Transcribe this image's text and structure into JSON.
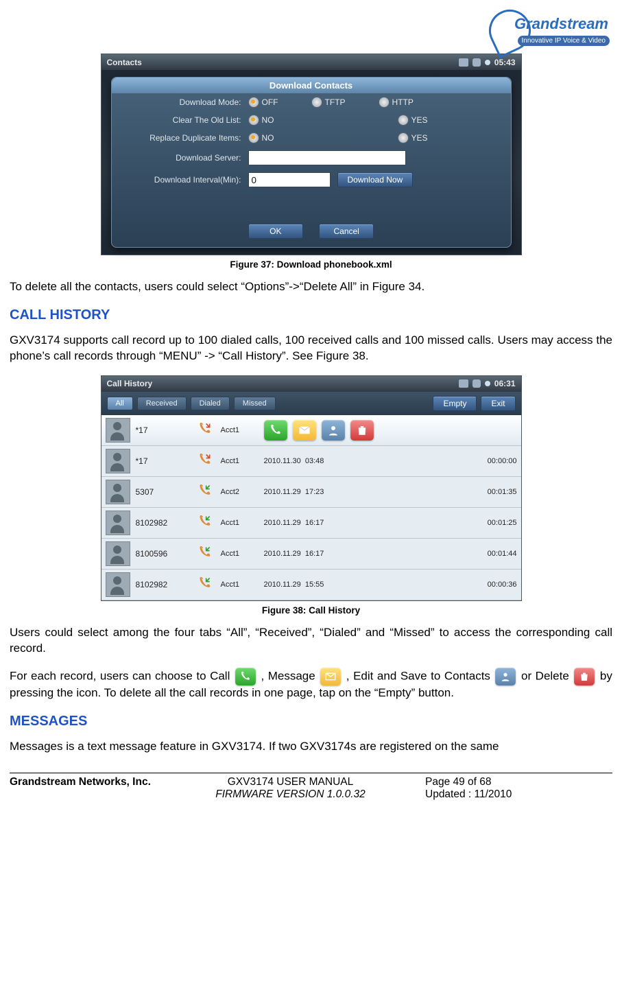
{
  "logo": {
    "brand": "Grandstream",
    "tagline": "Innovative IP Voice & Video"
  },
  "figure37": {
    "title": "Contacts",
    "clock": "05:43",
    "modal_title": "Download Contacts",
    "labels": {
      "mode": "Download Mode:",
      "clear": "Clear The Old List:",
      "replace": "Replace Duplicate Items:",
      "server": "Download Server:",
      "interval": "Download Interval(Min):"
    },
    "opts": {
      "off": "OFF",
      "tftp": "TFTP",
      "http": "HTTP",
      "no": "NO",
      "yes": "YES"
    },
    "interval_value": "0",
    "btn_download": "Download Now",
    "btn_ok": "OK",
    "btn_cancel": "Cancel",
    "caption": "Figure 37: Download phonebook.xml"
  },
  "para_delete": "To delete all the contacts, users could select “Options”->“Delete All” in Figure 34.",
  "heading_callhistory": "CALL HISTORY",
  "para_callhistory": "GXV3174 supports call record up to 100 dialed calls, 100 received calls and 100 missed calls. Users may access the phone’s call records through “MENU” -> “Call History”. See Figure 38.",
  "figure38": {
    "title": "Call History",
    "clock": "06:31",
    "tabs": {
      "all": "All",
      "received": "Received",
      "dialed": "Dialed",
      "missed": "Missed"
    },
    "btn_empty": "Empty",
    "btn_exit": "Exit",
    "rows": [
      {
        "num": "*17",
        "acct": "Acct1",
        "date": "",
        "time": "",
        "dur": "",
        "type": "missed",
        "hl": true
      },
      {
        "num": "*17",
        "acct": "Acct1",
        "date": "2010.11.30",
        "time": "03:48",
        "dur": "00:00:00",
        "type": "missed"
      },
      {
        "num": "5307",
        "acct": "Acct2",
        "date": "2010.11.29",
        "time": "17:23",
        "dur": "00:01:35",
        "type": "received"
      },
      {
        "num": "8102982",
        "acct": "Acct1",
        "date": "2010.11.29",
        "time": "16:17",
        "dur": "00:01:25",
        "type": "received"
      },
      {
        "num": "8100596",
        "acct": "Acct1",
        "date": "2010.11.29",
        "time": "16:17",
        "dur": "00:01:44",
        "type": "received"
      },
      {
        "num": "8102982",
        "acct": "Acct1",
        "date": "2010.11.29",
        "time": "15:55",
        "dur": "00:00:36",
        "type": "received"
      }
    ],
    "caption": "Figure 38: Call History"
  },
  "para_tabs": "Users could select among the four tabs “All”, “Received”, “Dialed” and “Missed” to access the corresponding call record.",
  "para_actions": {
    "p1": "For each record, users can choose to Call",
    "p2": ", Message",
    "p3": ", Edit and Save to Contacts",
    "p4": " or Delete",
    "p5": " by pressing the icon. To delete all the call records in one page, tap on the “Empty” button."
  },
  "heading_messages": "MESSAGES",
  "para_messages": "Messages is a text message feature in GXV3174. If two GXV3174s are registered on the same",
  "footer": {
    "company": "Grandstream Networks, Inc.",
    "manual": "GXV3174 USER MANUAL",
    "firmware": "FIRMWARE VERSION 1.0.0.32",
    "page": "Page 49 of 68",
    "updated": "Updated : 11/2010"
  }
}
